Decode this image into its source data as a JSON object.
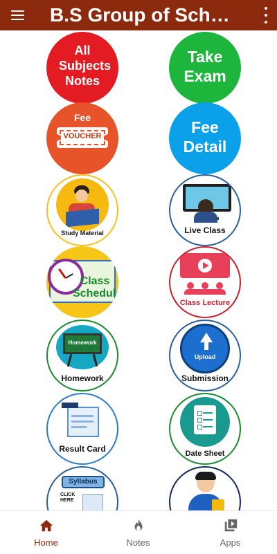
{
  "app": {
    "title": "B.S Group of Scho…"
  },
  "tiles": [
    {
      "label": "All Subjects Notes",
      "color": "#e31b23"
    },
    {
      "label": "Take Exam",
      "color": "#1db53c"
    },
    {
      "label": "Fee",
      "sub": "VOUCHER",
      "color": "#e8542a"
    },
    {
      "label": "Fee Detail",
      "color": "#0aa0ea"
    },
    {
      "label": "Study Material",
      "icon": "reading-student-icon"
    },
    {
      "label": "Live Class",
      "icon": "computer-student-icon"
    },
    {
      "label": "Class Schedule",
      "icon": "alarm-clock-icon"
    },
    {
      "label": "Class Lecture",
      "icon": "video-lecture-icon"
    },
    {
      "label": "Homework",
      "board": "Homework",
      "icon": "chalkboard-icon"
    },
    {
      "label": "Submission",
      "button": "Upload",
      "icon": "upload-icon"
    },
    {
      "label": "Result Card",
      "icon": "report-card-icon"
    },
    {
      "label": "Date Sheet",
      "icon": "checklist-icon"
    },
    {
      "label": "Syllabus",
      "note": "CLICK HERE",
      "icon": "syllabus-icon"
    },
    {
      "label": "",
      "icon": "user-lock-icon"
    }
  ],
  "nav": {
    "items": [
      {
        "label": "Home",
        "icon": "home-icon",
        "active": true
      },
      {
        "label": "Notes",
        "icon": "flame-icon",
        "active": false
      },
      {
        "label": "Apps",
        "icon": "apps-icon",
        "active": false
      }
    ],
    "active_color": "#8b2a0c",
    "inactive_color": "#666666"
  }
}
